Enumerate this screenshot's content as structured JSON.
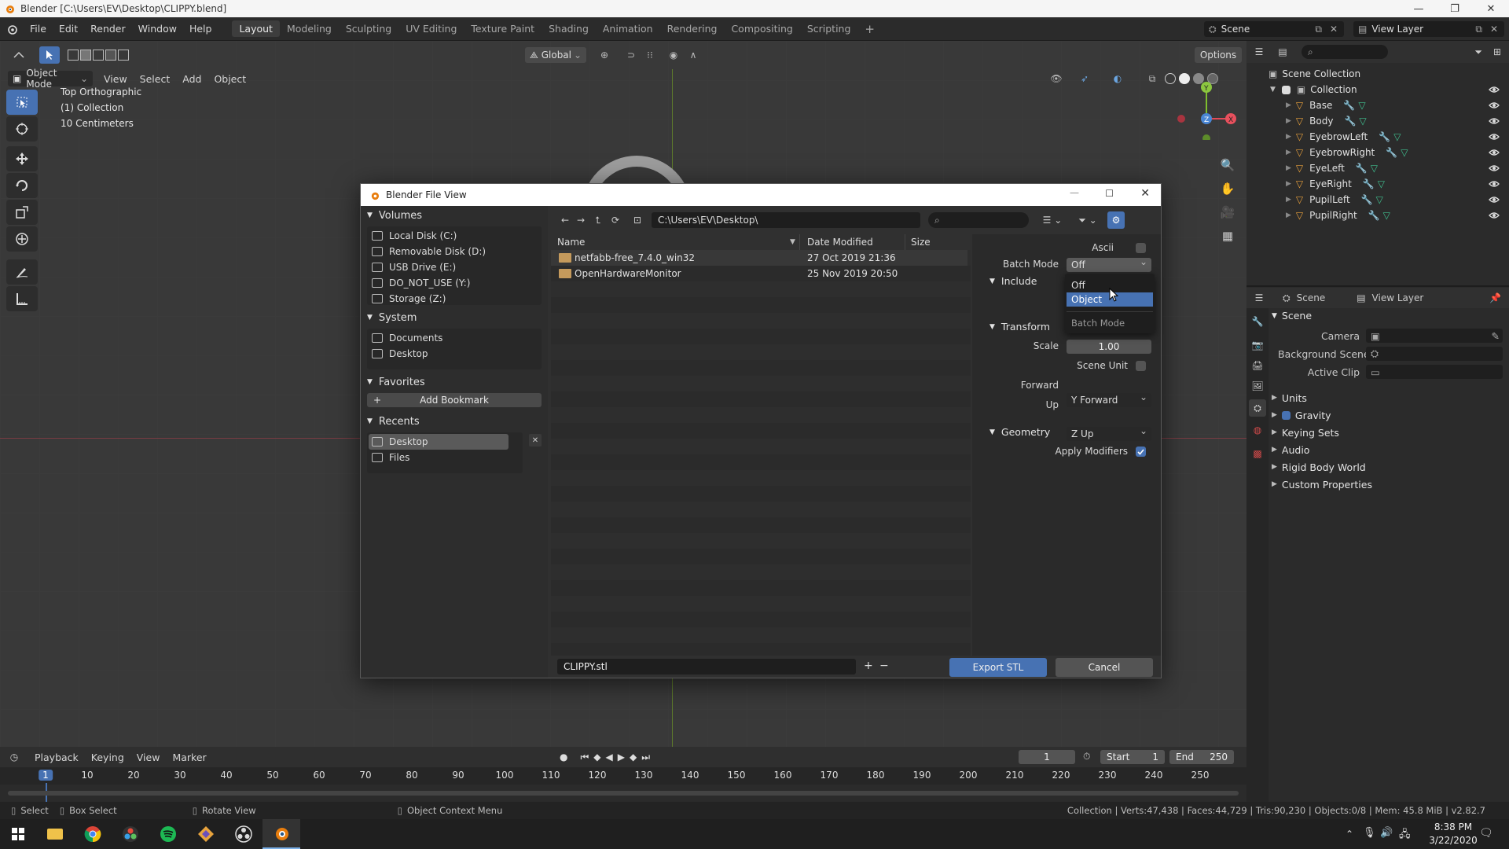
{
  "window": {
    "title": "Blender [C:\\Users\\EV\\Desktop\\CLIPPY.blend]"
  },
  "menus": [
    "File",
    "Edit",
    "Render",
    "Window",
    "Help"
  ],
  "workspaces": [
    "Layout",
    "Modeling",
    "Sculpting",
    "UV Editing",
    "Texture Paint",
    "Shading",
    "Animation",
    "Rendering",
    "Compositing",
    "Scripting"
  ],
  "scene": {
    "name": "Scene",
    "view_layer": "View Layer"
  },
  "viewport": {
    "mode": "Object Mode",
    "menus": [
      "View",
      "Select",
      "Add",
      "Object"
    ],
    "transform": "Global",
    "options": "Options",
    "overlay": [
      "Top Orthographic",
      "(1) Collection",
      "10 Centimeters"
    ]
  },
  "outliner": {
    "root": "Scene Collection",
    "collection": "Collection",
    "items": [
      "Base",
      "Body",
      "EyebrowLeft",
      "EyebrowRight",
      "EyeLeft",
      "EyeRight",
      "PupilLeft",
      "PupilRight"
    ]
  },
  "properties": {
    "tab_scene": "Scene",
    "tab_view_layer": "View Layer",
    "section": "Scene",
    "camera": "Camera",
    "background_scene": "Background Scene",
    "active_clip": "Active Clip",
    "panels": [
      "Units",
      "Gravity",
      "Keying Sets",
      "Audio",
      "Rigid Body World",
      "Custom Properties"
    ]
  },
  "timeline": {
    "menus": [
      "Playback",
      "Keying",
      "View",
      "Marker"
    ],
    "current_frame": "1",
    "start_label": "Start",
    "start": "1",
    "end_label": "End",
    "end": "250",
    "ruler": [
      "1",
      "10",
      "20",
      "30",
      "40",
      "50",
      "60",
      "70",
      "80",
      "90",
      "100",
      "110",
      "120",
      "130",
      "140",
      "150",
      "160",
      "170",
      "180",
      "190",
      "200",
      "210",
      "220",
      "230",
      "240",
      "250"
    ]
  },
  "status": {
    "select": "Select",
    "box_select": "Box Select",
    "rotate_view": "Rotate View",
    "context_menu": "Object Context Menu",
    "stats": "Collection | Verts:47,438 | Faces:44,729 | Tris:90,230 | Objects:0/8 | Mem: 45.8 MiB | v2.82.7"
  },
  "taskbar": {
    "time": "8:38 PM",
    "date": "3/22/2020"
  },
  "dialog": {
    "title": "Blender File View",
    "path": "C:\\Users\\EV\\Desktop\\",
    "volumes_header": "Volumes",
    "volumes": [
      "Local Disk (C:)",
      "Removable Disk (D:)",
      "USB Drive (E:)",
      "DO_NOT_USE (Y:)",
      "Storage (Z:)"
    ],
    "system_header": "System",
    "system": [
      "Documents",
      "Desktop"
    ],
    "favorites_header": "Favorites",
    "add_bookmark": "Add Bookmark",
    "recents_header": "Recents",
    "recents": [
      "Desktop",
      "Files"
    ],
    "columns": {
      "name": "Name",
      "date": "Date Modified",
      "size": "Size"
    },
    "files": [
      {
        "name": "netfabb-free_7.4.0_win32",
        "date": "27 Oct 2019 21:36"
      },
      {
        "name": "OpenHardwareMonitor",
        "date": "25 Nov 2019 20:50"
      }
    ],
    "filename": "CLIPPY.stl",
    "export_button": "Export STL",
    "cancel_button": "Cancel",
    "options": {
      "ascii": "Ascii",
      "batch_mode_label": "Batch Mode",
      "batch_mode_value": "Off",
      "dropdown_items": [
        "Off",
        "Object"
      ],
      "dropdown_title": "Batch Mode",
      "include": "Include",
      "transform": "Transform",
      "scale_label": "Scale",
      "scale_value": "1.00",
      "scene_unit": "Scene Unit",
      "forward_label": "Forward",
      "forward_value": "Y Forward",
      "up_label": "Up",
      "up_value": "Z Up",
      "geometry": "Geometry",
      "apply_modifiers": "Apply Modifiers"
    }
  }
}
